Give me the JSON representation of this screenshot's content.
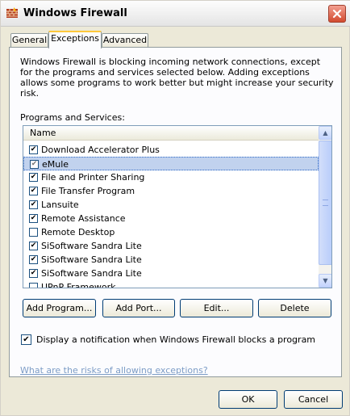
{
  "window": {
    "title": "Windows Firewall",
    "app_icon": "firewall-icon",
    "close_icon": "close-icon"
  },
  "tabs": [
    {
      "label": "General"
    },
    {
      "label": "Exceptions",
      "active": true
    },
    {
      "label": "Advanced"
    }
  ],
  "exceptions": {
    "description": "Windows Firewall is blocking incoming network connections, except for the programs and services selected below. Adding exceptions allows some programs to work better but might increase your security risk.",
    "list_label": "Programs and Services:",
    "column_header": "Name",
    "items": [
      {
        "label": "Download Accelerator Plus",
        "checked": true
      },
      {
        "label": "eMule",
        "checked": true,
        "selected": true
      },
      {
        "label": "File and Printer Sharing",
        "checked": true
      },
      {
        "label": "File Transfer Program",
        "checked": true
      },
      {
        "label": "Lansuite",
        "checked": true
      },
      {
        "label": "Remote Assistance",
        "checked": true
      },
      {
        "label": "Remote Desktop",
        "checked": false
      },
      {
        "label": "SiSoftware Sandra Lite",
        "checked": true
      },
      {
        "label": "SiSoftware Sandra Lite",
        "checked": true
      },
      {
        "label": "SiSoftware Sandra Lite",
        "checked": true
      },
      {
        "label": "UPnP Framework",
        "checked": false
      }
    ],
    "buttons": {
      "add_program": "Add Program...",
      "add_port": "Add Port...",
      "edit": "Edit...",
      "delete": "Delete"
    },
    "notify": {
      "label": "Display a notification when Windows Firewall blocks a program",
      "checked": true
    },
    "help_link": "What are the risks of allowing exceptions?"
  },
  "footer": {
    "ok": "OK",
    "cancel": "Cancel"
  }
}
